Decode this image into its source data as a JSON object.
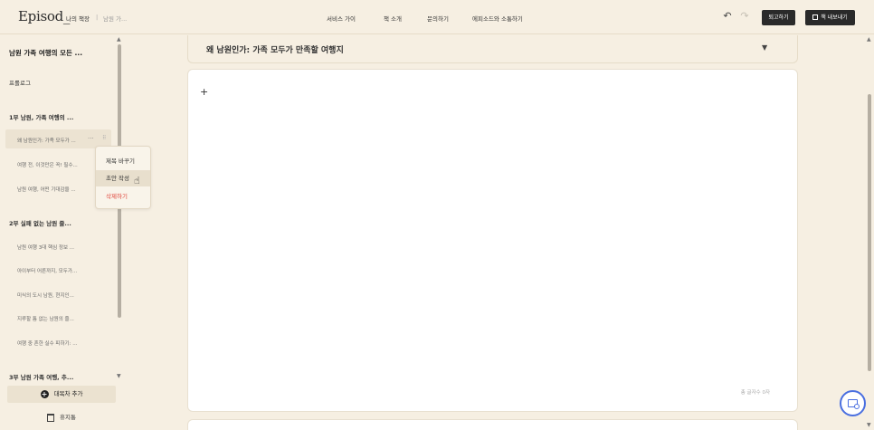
{
  "header": {
    "logo": "Episod_",
    "breadcrumb": [
      "나의 책장",
      "|",
      "남원 가..."
    ],
    "nav": [
      "서비스 가이",
      "책 소개",
      "문의하기",
      "에피소드와 소통하기"
    ],
    "undo_icon": "undo-icon",
    "redo_icon": "redo-icon",
    "submit_label": "퇴고하기",
    "export_label": "책 내보내기"
  },
  "sidebar": {
    "book_title": "남원 가족 여행의 모든 ...",
    "prologue": "프롤로그",
    "chapters": [
      {
        "title": "1부 남원, 가족 여행의 ...",
        "sections": [
          "왜 남원인가: 가족 모두가 ...",
          "여행 전, 이것만은 꼭! 필수...",
          "남원 여행, 어떤 기대감을 ..."
        ]
      },
      {
        "title": "2부 실패 없는 남원 즐...",
        "sections": [
          "남원 여행 3대 핵심 정보 ...",
          "아이부터 어른까지, 모두가...",
          "미식의 도시 남원, 현지인...",
          "지루할 틈 없는 남원의 즐...",
          "여행 중 흔한 실수 피하기: ..."
        ]
      },
      {
        "title": "3부 남원 가족 여행, 추...",
        "sections": []
      }
    ],
    "more_icon": "more-dots-icon",
    "add_chapter_label": "대목차 추가",
    "trash_label": "휴지통"
  },
  "context_menu": {
    "items": [
      "제목 바꾸기",
      "초안 작성",
      "삭제하기"
    ]
  },
  "main": {
    "chapter_title": "왜 남원인가: 가족 모두가 만족할 여행지",
    "editor_plus": "+",
    "char_count": "총 글자수 0자"
  },
  "colors": {
    "background": "#f6efe2",
    "accent_blue": "#4a6fe0",
    "danger": "#e0463c"
  }
}
